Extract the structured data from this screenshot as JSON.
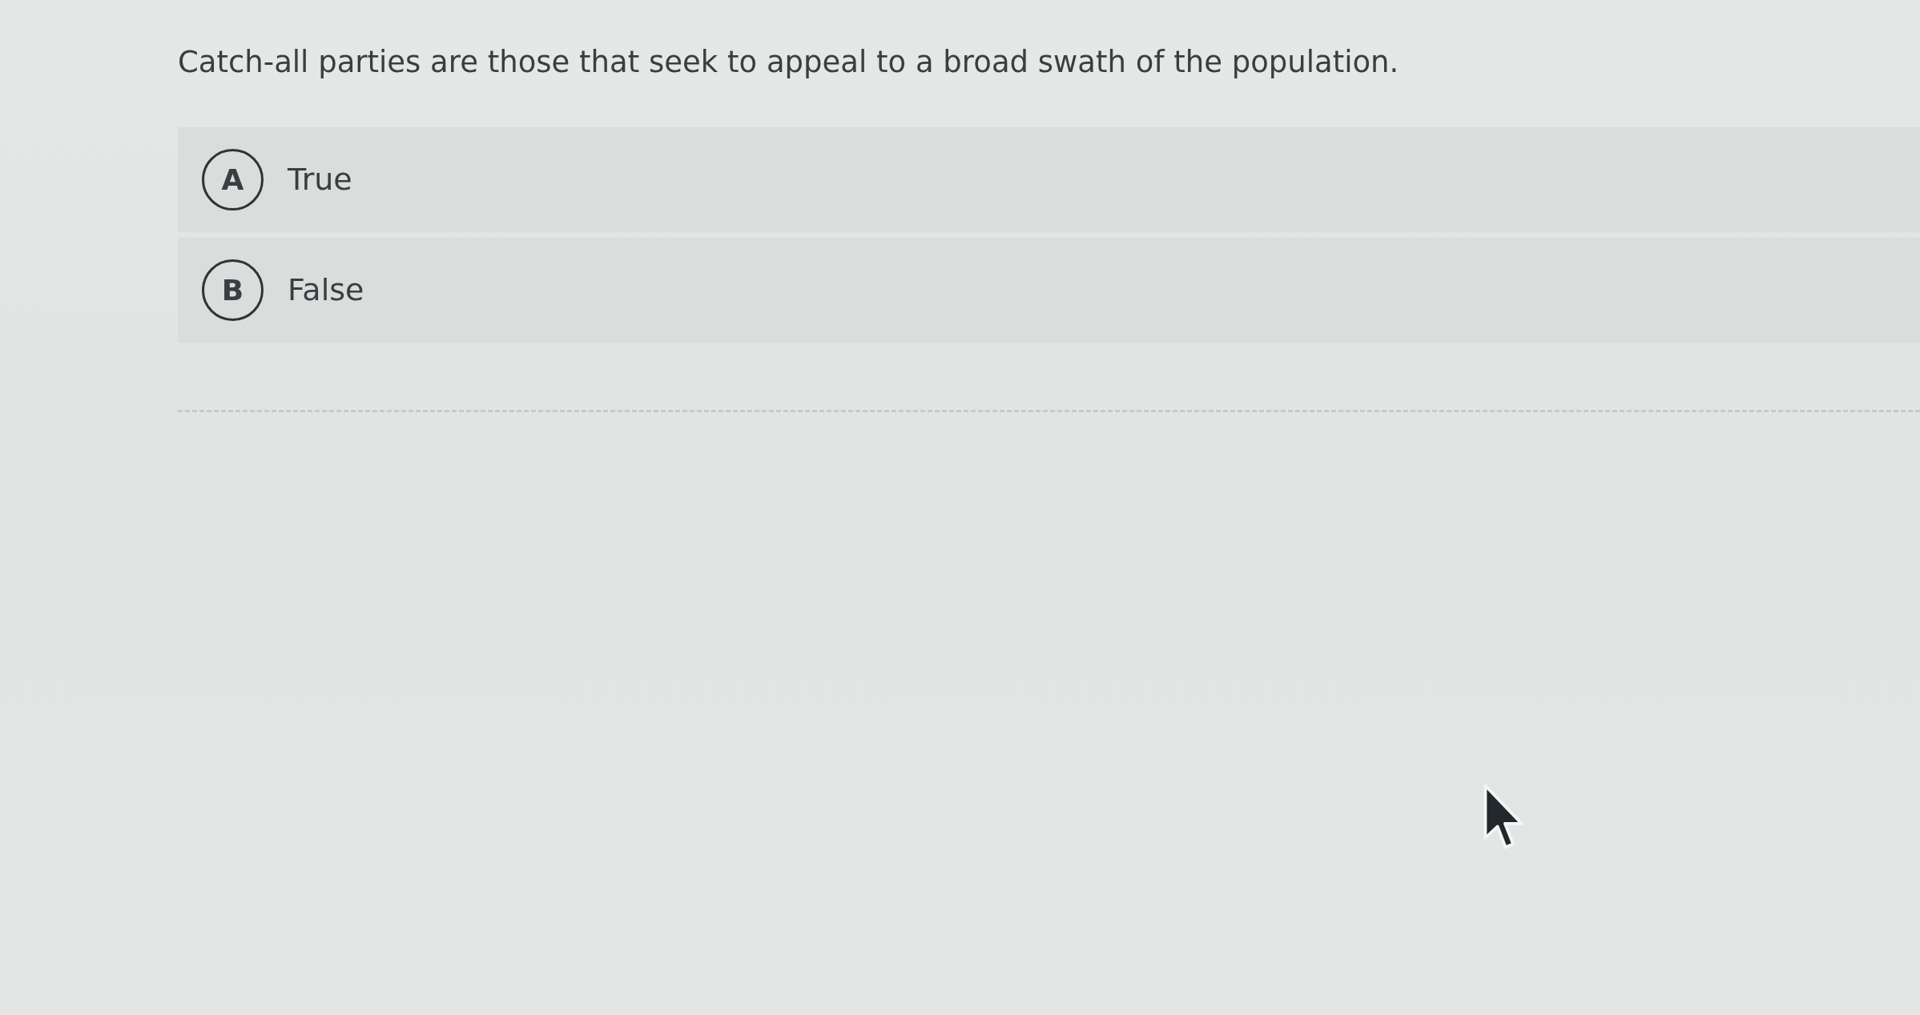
{
  "question": "Catch-all parties are those that seek to appeal to a broad swath of the population.",
  "options": [
    {
      "letter": "A",
      "label": "True",
      "selected": false
    },
    {
      "letter": "B",
      "label": "False",
      "selected": false
    }
  ]
}
